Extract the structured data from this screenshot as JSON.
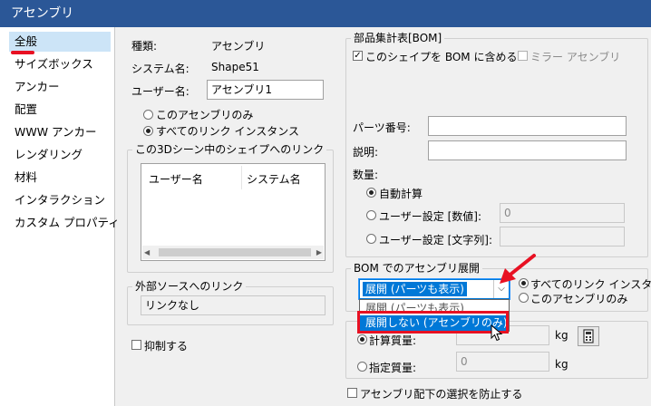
{
  "window": {
    "title": "アセンブリ"
  },
  "sidebar": {
    "items": [
      {
        "label": "全般"
      },
      {
        "label": "サイズボックス"
      },
      {
        "label": "アンカー"
      },
      {
        "label": "配置"
      },
      {
        "label": "WWW アンカー"
      },
      {
        "label": "レンダリング"
      },
      {
        "label": "材料"
      },
      {
        "label": "インタラクション"
      },
      {
        "label": "カスタム プロパティ"
      }
    ],
    "selected_index": 0
  },
  "general": {
    "type_label": "種類:",
    "type_value": "アセンブリ",
    "system_name_label": "システム名:",
    "system_name_value": "Shape51",
    "user_name_label": "ユーザー名:",
    "user_name_value": "アセンブリ1",
    "radio_this_only": "このアセンブリのみ",
    "radio_all_links": "すべてのリンク インスタンス",
    "radio_selected": "all_links"
  },
  "links_group": {
    "title": "この3Dシーン中のシェイプへのリンク",
    "columns": [
      "ユーザー名",
      "システム名"
    ],
    "rows": []
  },
  "external_group": {
    "title": "外部ソースへのリンク",
    "value": "リンクなし"
  },
  "suppress": {
    "label": "抑制する",
    "checked": false
  },
  "bom": {
    "title": "部品集計表[BOM]",
    "include_label": "このシェイプを BOM に含める",
    "include_checked": true,
    "mirror_label": "ミラー アセンブリ",
    "mirror_checked": false,
    "part_number_label": "パーツ番号:",
    "part_number_value": "",
    "description_label": "説明:",
    "description_value": "",
    "quantity_label": "数量:",
    "auto_calc_label": "自動計算",
    "user_numeric_label": "ユーザー設定 [数値]:",
    "user_numeric_value": "0",
    "user_text_label": "ユーザー設定 [文字列]:",
    "user_text_value": "",
    "quantity_selected": "auto"
  },
  "bom_expand": {
    "title": "BOM でのアセンブリ展開",
    "combo_value": "展開 (パーツも表示)",
    "options": [
      "展開 (パーツも表示)",
      "展開しない (アセンブリのみ)"
    ],
    "highlighted_option": 1,
    "radio_all_links": "すべてのリンク インスタンス",
    "radio_this_only": "このアセンブリのみ",
    "radio_selected": "all_links"
  },
  "mass": {
    "calc_label": "計算質量:",
    "calc_unit": "kg",
    "specified_label": "指定質量:",
    "specified_value": "0",
    "specified_unit": "kg",
    "selected": "calc",
    "calc_button_icon": "calculator-icon"
  },
  "prevent": {
    "label": "アセンブリ配下の選択を防止する",
    "checked": false
  },
  "annotations": {
    "arrow_color": "#e81123",
    "highlight_color": "#e81123"
  }
}
